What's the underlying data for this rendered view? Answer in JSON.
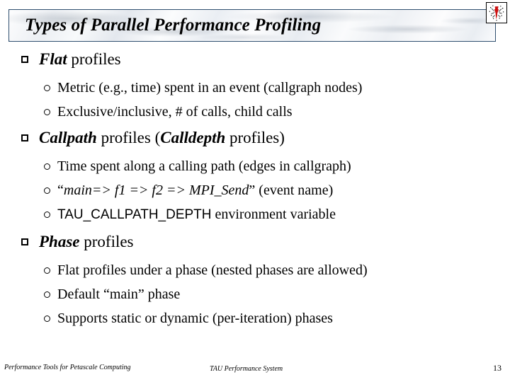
{
  "slide": {
    "title": "Types of Parallel Performance Profiling",
    "logo_name": "red-ink-splatter-logo"
  },
  "content": {
    "groups": [
      {
        "heading_emphasis": "Flat",
        "heading_rest": " profiles",
        "subitems": [
          {
            "text": "Metric (e.g., time) spent in an event (callgraph nodes)"
          },
          {
            "text": "Exclusive/inclusive, # of calls, child calls"
          }
        ]
      },
      {
        "heading_emphasis": "Callpath",
        "heading_mid": " profiles (",
        "heading_emphasis2": "Calldepth",
        "heading_rest": " profiles)",
        "subitems": [
          {
            "text": "Time spent along a calling path (edges in callgraph)"
          },
          {
            "quote_open": "“",
            "italic": "main=> f1 => f2 => MPI_Send",
            "quote_close": "”",
            "tail": " (event name)"
          },
          {
            "mono": "TAU_CALLPATH_DEPTH",
            "tail": " environment variable"
          }
        ]
      },
      {
        "heading_emphasis": "Phase",
        "heading_rest": " profiles",
        "subitems": [
          {
            "text": "Flat profiles under a phase (nested phases are allowed)"
          },
          {
            "text": "Default “main” phase"
          },
          {
            "text": "Supports static or dynamic (per-iteration) phases"
          }
        ]
      }
    ]
  },
  "footer": {
    "left": "Performance Tools for Petascale Computing",
    "center": "TAU Performance System",
    "page_number": "13"
  },
  "colors": {
    "text": "#000000",
    "title_border": "#2f4f6f",
    "logo_red": "#cc1111",
    "background": "#ffffff"
  }
}
